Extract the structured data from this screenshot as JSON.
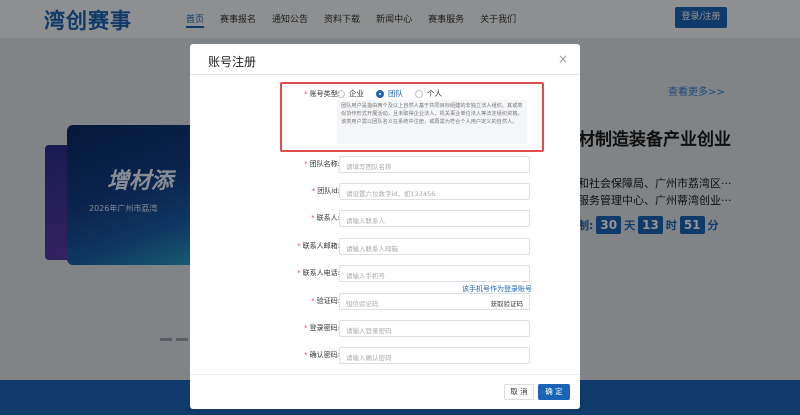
{
  "site": {
    "logo": "湾创赛事",
    "nav": [
      "首页",
      "赛事报名",
      "通知公告",
      "资料下载",
      "新闻中心",
      "赛事服务",
      "关于我们"
    ],
    "login_button": "登录/注册"
  },
  "background": {
    "see_more": "查看更多>>",
    "headline": "材制造装备产业创业",
    "line1": "和社会保障局、广州市荔湾区···",
    "line2": "服务管理中心、广州蒂湾创业···",
    "countdown_prefix": "制:",
    "countdown": {
      "days": "30",
      "day_unit": "天",
      "hours": "13",
      "hour_unit": "时",
      "minutes": "51",
      "minute_unit": "分"
    },
    "banner_title": "增材添",
    "banner_sub": "2026年广州市荔湾"
  },
  "modal": {
    "title": "账号注册",
    "close": "×",
    "account_type": {
      "label": "账号类型:",
      "options": [
        "企业",
        "团队",
        "个人"
      ],
      "selected": "团队",
      "note": "团队用户是指由两个及以上自然人基于共同目标组建的非独立法人组织。其或类似协作形式开展活动，且未取得企业法人、机关事业单位法人等法定组织资格。该类用户需以团队名义在系统中注册，或再需为符合个人用户定义的自然人。"
    },
    "fields": [
      {
        "label": "团队名称:",
        "placeholder": "请填写团队名称"
      },
      {
        "label": "团队id:",
        "placeholder": "请设置六位数字id，如123456"
      },
      {
        "label": "联系人:",
        "placeholder": "请输入联系人"
      },
      {
        "label": "联系人邮箱:",
        "placeholder": "请输入联系人邮箱"
      },
      {
        "label": "联系人电话:",
        "placeholder": "请输入手机号"
      },
      {
        "label": "验证码:",
        "placeholder": "短信验证码",
        "action": "获取验证码"
      },
      {
        "label": "登录密码:",
        "placeholder": "请输入登录密码"
      },
      {
        "label": "确认密码:",
        "placeholder": "请输入确认密码"
      }
    ],
    "phone_hint": "该手机号作为登录账号",
    "cancel": "取 消",
    "confirm": "确 定"
  }
}
